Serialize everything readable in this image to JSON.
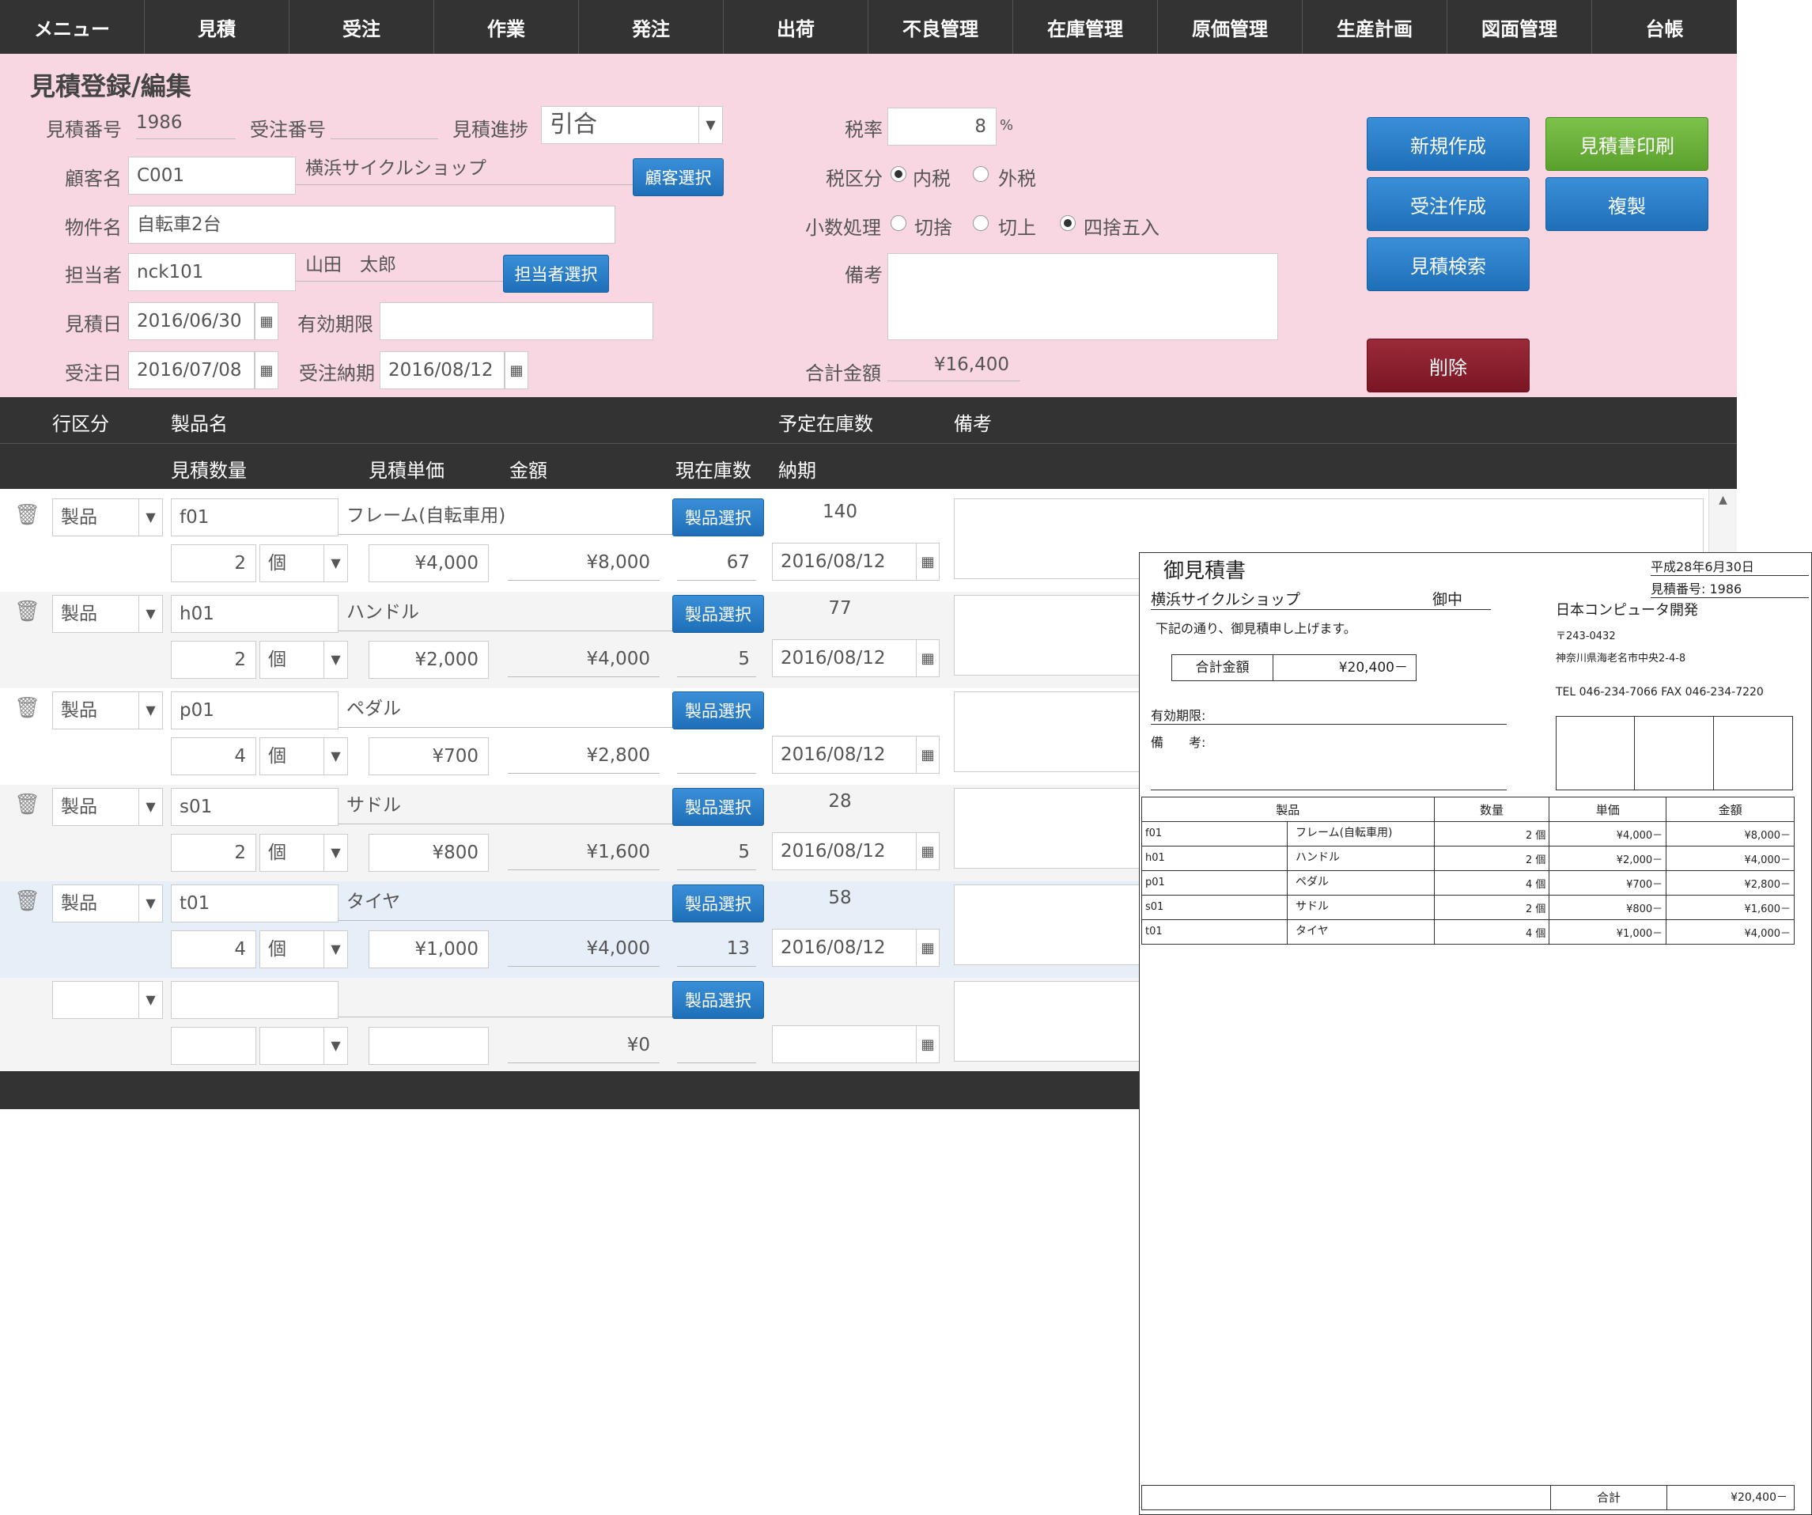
{
  "nav": [
    "メニュー",
    "見積",
    "受注",
    "作業",
    "発注",
    "出荷",
    "不良管理",
    "在庫管理",
    "原価管理",
    "生産計画",
    "図面管理",
    "台帳"
  ],
  "form": {
    "title": "見積登録/編集",
    "estimate_no_label": "見積番号",
    "estimate_no": "1986",
    "order_no_label": "受注番号",
    "order_no": "",
    "progress_label": "見積進捗",
    "progress_value": "引合",
    "tax_rate_label": "税率",
    "tax_rate": "8",
    "tax_rate_unit": "%",
    "tax_type_label": "税区分",
    "tax_type_options": [
      "内税",
      "外税"
    ],
    "rounding_label": "小数処理",
    "rounding_options": [
      "切捨",
      "切上",
      "四捨五入"
    ],
    "customer_label": "顧客名",
    "customer_code": "C001",
    "customer_name": "横浜サイクルショップ",
    "customer_select": "顧客選択",
    "property_label": "物件名",
    "property_value": "自転車2台",
    "staff_label": "担当者",
    "staff_code": "nck101",
    "staff_name": "山田　太郎",
    "staff_select": "担当者選択",
    "remarks_label": "備考",
    "estimate_date_label": "見積日",
    "estimate_date": "2016/06/30",
    "valid_label": "有効期限",
    "valid_value": "",
    "order_date_label": "受注日",
    "order_date": "2016/07/08",
    "delivery_label": "受注納期",
    "delivery_date": "2016/08/12",
    "total_label": "合計金額",
    "total_value": "¥16,400",
    "buttons": {
      "new": "新規作成",
      "print": "見積書印刷",
      "order": "受注作成",
      "copy": "複製",
      "search": "見積検索",
      "delete": "削除"
    }
  },
  "grid": {
    "header1": {
      "row_type": "行区分",
      "product_name": "製品名",
      "planned_stock": "予定在庫数",
      "remarks": "備考"
    },
    "header2": {
      "qty": "見積数量",
      "unit_price": "見積単価",
      "amount": "金額",
      "current_stock": "現在庫数",
      "due": "納期"
    },
    "select_label": "製品選択",
    "rows": [
      {
        "type": "製品",
        "code": "f01",
        "name": "フレーム(自転車用)",
        "planned": "140",
        "qty": "2",
        "unit": "個",
        "price": "¥4,000",
        "amount": "¥8,000",
        "stock": "67",
        "due": "2016/08/12"
      },
      {
        "type": "製品",
        "code": "h01",
        "name": "ハンドル",
        "planned": "77",
        "qty": "2",
        "unit": "個",
        "price": "¥2,000",
        "amount": "¥4,000",
        "stock": "5",
        "due": "2016/08/12"
      },
      {
        "type": "製品",
        "code": "p01",
        "name": "ペダル",
        "planned": "",
        "qty": "4",
        "unit": "個",
        "price": "¥700",
        "amount": "¥2,800",
        "stock": "",
        "due": "2016/08/12"
      },
      {
        "type": "製品",
        "code": "s01",
        "name": "サドル",
        "planned": "28",
        "qty": "2",
        "unit": "個",
        "price": "¥800",
        "amount": "¥1,600",
        "stock": "5",
        "due": "2016/08/12"
      },
      {
        "type": "製品",
        "code": "t01",
        "name": "タイヤ",
        "planned": "58",
        "qty": "4",
        "unit": "個",
        "price": "¥1,000",
        "amount": "¥4,000",
        "stock": "13",
        "due": "2016/08/12"
      },
      {
        "type": "",
        "code": "",
        "name": "",
        "planned": "",
        "qty": "",
        "unit": "",
        "price": "",
        "amount": "¥0",
        "stock": "",
        "due": ""
      }
    ]
  },
  "doc": {
    "title": "御見積書",
    "date": "平成28年6月30日",
    "estimate_no": "見積番号:  1986",
    "customer": "横浜サイクルショップ",
    "honorific": "御中",
    "message": "下記の通り、御見積申し上げます。",
    "total_label": "合計金額",
    "total_value": "¥20,400－",
    "company": "日本コンピュータ開発",
    "zip": "〒243-0432",
    "address": "神奈川県海老名市中央2-4-8",
    "tel": "TEL  046-234-7066   FAX  046-234-7220",
    "valid_label": "有効期限:",
    "remarks_label": "備　　考:",
    "headers": [
      "製品",
      "数量",
      "単価",
      "金額"
    ],
    "rows": [
      {
        "code": "f01",
        "name": "フレーム(自転車用)",
        "qty": "2 個",
        "price": "¥4,000－",
        "amount": "¥8,000－"
      },
      {
        "code": "h01",
        "name": "ハンドル",
        "qty": "2 個",
        "price": "¥2,000－",
        "amount": "¥4,000－"
      },
      {
        "code": "p01",
        "name": "ペダル",
        "qty": "4 個",
        "price": "¥700－",
        "amount": "¥2,800－"
      },
      {
        "code": "s01",
        "name": "サドル",
        "qty": "2 個",
        "price": "¥800－",
        "amount": "¥1,600－"
      },
      {
        "code": "t01",
        "name": "タイヤ",
        "qty": "4 個",
        "price": "¥1,000－",
        "amount": "¥4,000－"
      }
    ],
    "footer_label": "合計",
    "footer_value": "¥20,400－"
  }
}
